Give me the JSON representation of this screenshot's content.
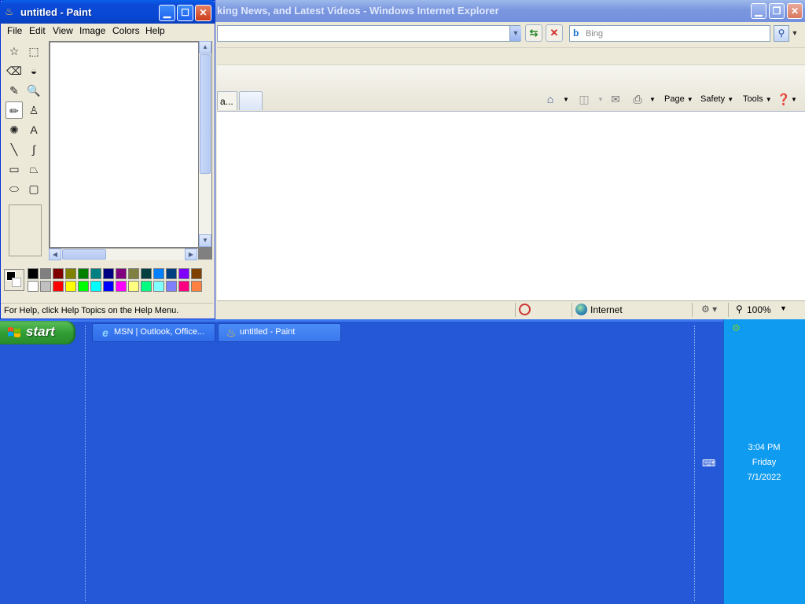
{
  "ie": {
    "title": "king News, and Latest Videos - Windows Internet Explorer",
    "search_placeholder": "Bing",
    "tab_label": "a...",
    "commands": {
      "page": "Page",
      "safety": "Safety",
      "tools": "Tools"
    },
    "status": {
      "zone": "Internet",
      "zoom": "100%"
    }
  },
  "paint": {
    "title": "untitled - Paint",
    "menu": [
      "File",
      "Edit",
      "View",
      "Image",
      "Colors",
      "Help"
    ],
    "status_text": "For Help, click Help Topics on the Help Menu.",
    "tools": [
      {
        "name": "free-form-select",
        "glyph": "☆"
      },
      {
        "name": "select",
        "glyph": "⬚"
      },
      {
        "name": "eraser",
        "glyph": "⌫"
      },
      {
        "name": "fill-with-color",
        "glyph": "◒"
      },
      {
        "name": "pick-color",
        "glyph": "✎"
      },
      {
        "name": "magnifier",
        "glyph": "🔍"
      },
      {
        "name": "pencil",
        "glyph": "✏"
      },
      {
        "name": "brush",
        "glyph": "♙"
      },
      {
        "name": "airbrush",
        "glyph": "✺"
      },
      {
        "name": "text",
        "glyph": "A"
      },
      {
        "name": "line",
        "glyph": "╲"
      },
      {
        "name": "curve",
        "glyph": "∫"
      },
      {
        "name": "rectangle",
        "glyph": "▭"
      },
      {
        "name": "polygon",
        "glyph": "⏢"
      },
      {
        "name": "ellipse",
        "glyph": "⬭"
      },
      {
        "name": "rounded-rectangle",
        "glyph": "▢"
      }
    ],
    "selected_tool": "pencil",
    "palette_row1": [
      "#000000",
      "#808080",
      "#800000",
      "#808000",
      "#008000",
      "#008080",
      "#000080",
      "#800080",
      "#808040",
      "#004040",
      "#0080ff",
      "#004080",
      "#8000ff",
      "#804000"
    ],
    "palette_row2": [
      "#ffffff",
      "#c0c0c0",
      "#ff0000",
      "#ffff00",
      "#00ff00",
      "#00ffff",
      "#0000ff",
      "#ff00ff",
      "#ffff80",
      "#00ff80",
      "#80ffff",
      "#8080ff",
      "#ff0080",
      "#ff8040"
    ]
  },
  "taskbar": {
    "start_label": "start",
    "tasks": [
      {
        "label": "MSN | Outlook, Office..."
      },
      {
        "label": "untitled - Paint"
      }
    ],
    "clock": {
      "time": "3:04 PM",
      "day": "Friday",
      "date": "7/1/2022"
    }
  }
}
